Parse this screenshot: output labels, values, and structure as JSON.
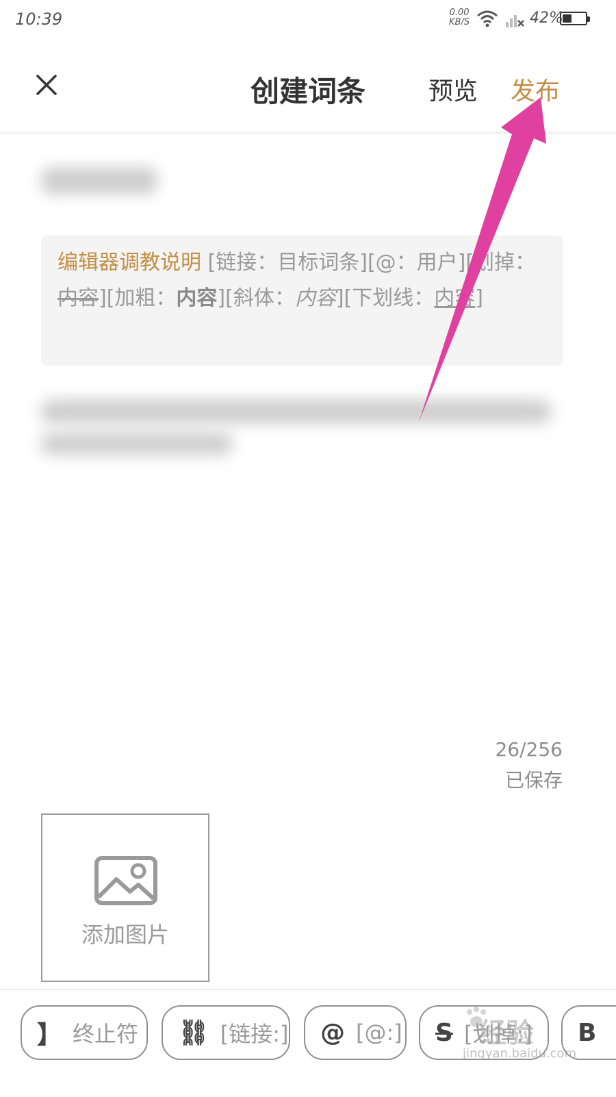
{
  "colors": {
    "accent": "#c38f46",
    "arrow": "#e040a0"
  },
  "status_bar": {
    "time": "10:39",
    "net_speed": "0.00",
    "net_unit": "KB/S",
    "battery_percent": "42%",
    "battery_level": 0.42
  },
  "header": {
    "title": "创建词条",
    "preview_label": "预览",
    "publish_label": "发布"
  },
  "hint": {
    "editor_guide": "编辑器调教说明",
    "link_open": " [链接：目标词条][@：用户][划掉：",
    "strike_text": "内容",
    "bold_open": "][加粗：",
    "bold_text": "内容",
    "italic_open": "][斜体：",
    "italic_text": "内容",
    "underline_open": "][下划线：",
    "underline_text": "内容",
    "close": "]"
  },
  "editor": {
    "char_count": "26/256",
    "save_status": "已保存"
  },
  "add_image": {
    "label": "添加图片",
    "icon": "image-icon"
  },
  "toolbar": {
    "items": [
      {
        "icon": "】",
        "label": "终止符"
      },
      {
        "icon": "⛓",
        "label": "[链接:]"
      },
      {
        "icon": "@",
        "label": "[@:]"
      },
      {
        "icon": "S",
        "label": "[划掉:]"
      },
      {
        "icon": "B",
        "label": ""
      }
    ]
  },
  "watermark": {
    "text": "经验",
    "url": "jingyan.baidu.com"
  }
}
